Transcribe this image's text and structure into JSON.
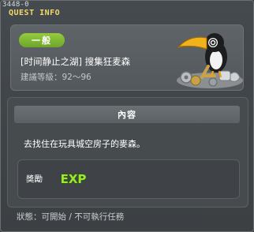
{
  "header": {
    "quest_id": "3448-0",
    "title": "QUEST INFO"
  },
  "quest": {
    "badge": "一般",
    "name": "[时间静止之湖] 搜集狂麦森",
    "level_label": "建議等級：",
    "level_range": "92～96",
    "npc_icon": "toucan-npc-icon"
  },
  "content": {
    "header": "內容",
    "description": "去找住在玩具城空房子的麥森。",
    "reward_label": "獎勵",
    "reward_icon": "exp-icon",
    "reward_text": "EXP"
  },
  "footer": {
    "status_label": "狀態：",
    "status_value": "可開始 / 不可執行任務"
  },
  "colors": {
    "title": "#f4d76a",
    "badge": "#8cc43a",
    "exp": "#9be82e"
  }
}
